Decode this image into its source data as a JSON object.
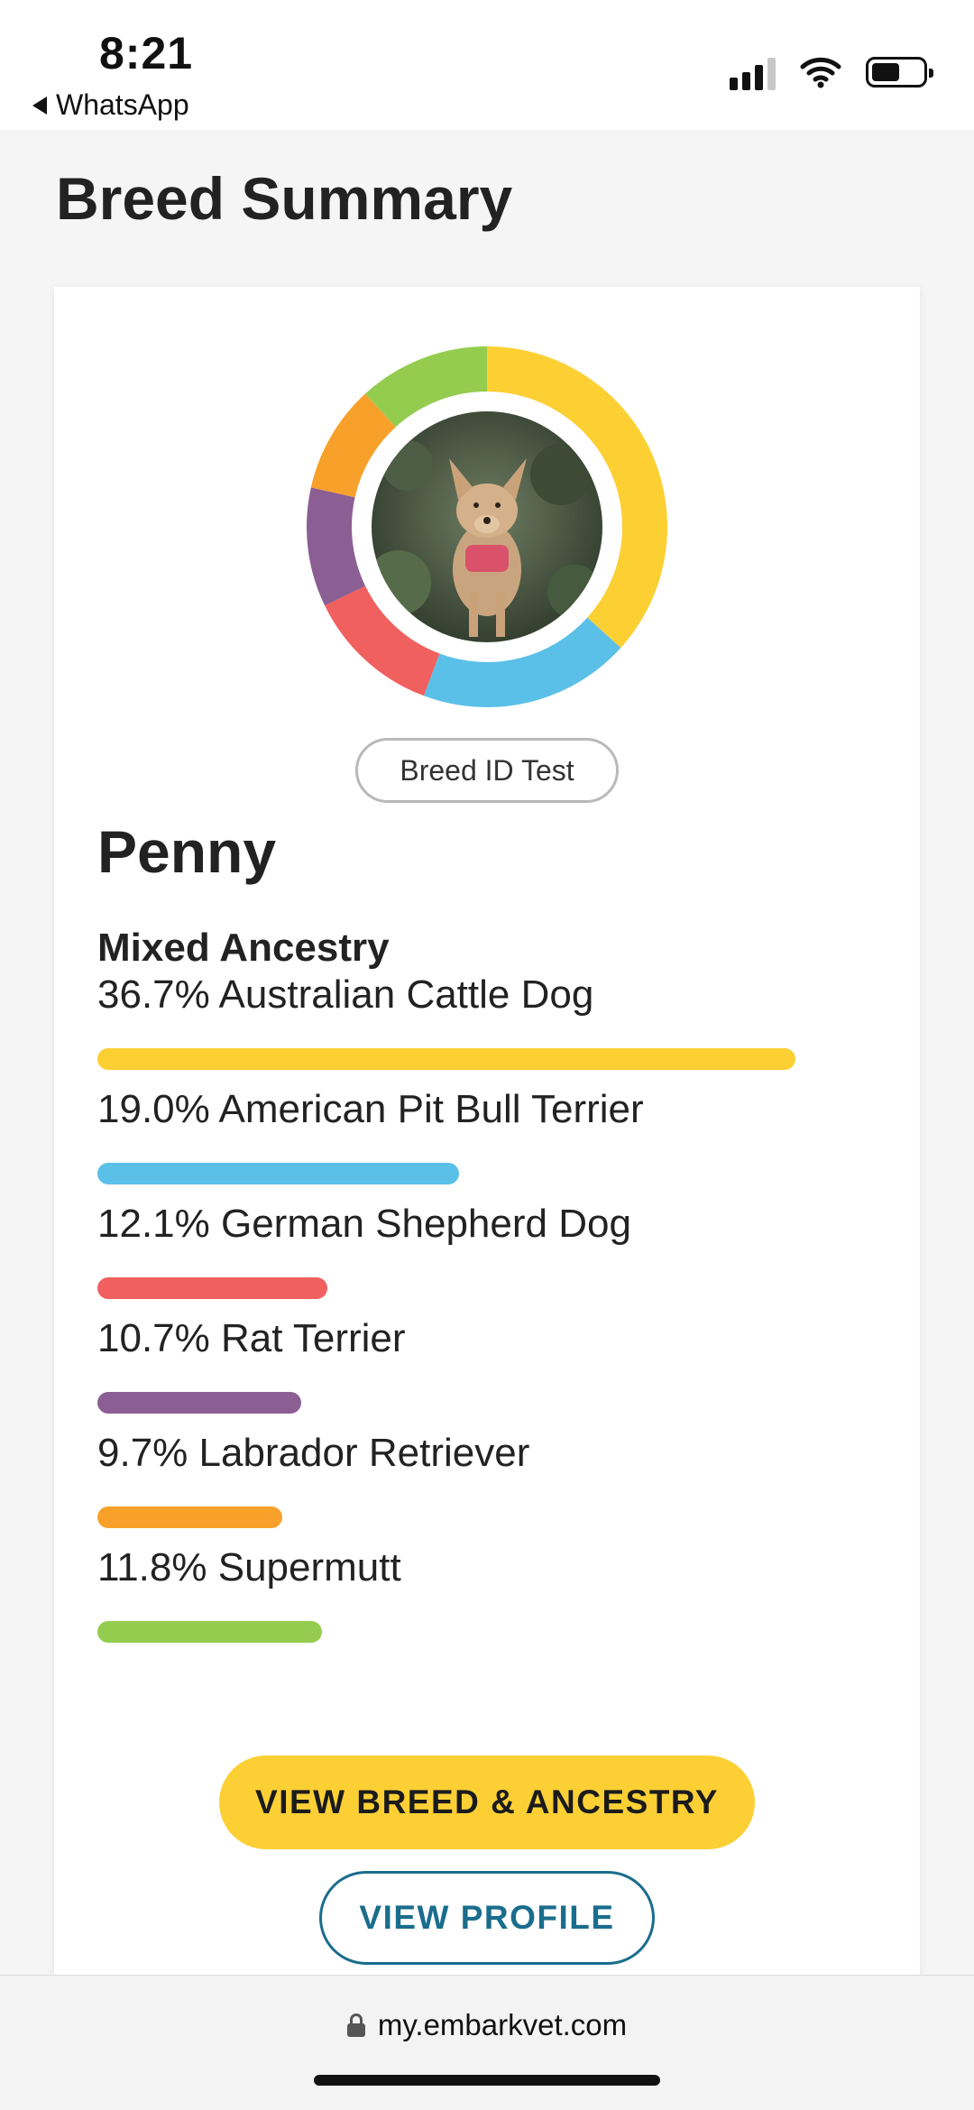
{
  "status_bar": {
    "time": "8:21",
    "back_app": "WhatsApp",
    "icons": [
      "cellular-signal-icon",
      "wifi-icon",
      "battery-icon"
    ]
  },
  "page": {
    "title": "Breed Summary"
  },
  "card": {
    "test_badge": "Breed ID Test",
    "dog_name": "Penny",
    "ancestry_heading": "Mixed Ancestry",
    "breeds": [
      {
        "label": "36.7% Australian Cattle Dog",
        "percent": 36.7,
        "color": "#fccf33"
      },
      {
        "label": "19.0% American Pit Bull Terrier",
        "percent": 19.0,
        "color": "#5bc0e8"
      },
      {
        "label": "12.1% German Shepherd Dog",
        "percent": 12.1,
        "color": "#f0605e"
      },
      {
        "label": "10.7% Rat Terrier",
        "percent": 10.7,
        "color": "#8c5f94"
      },
      {
        "label": "9.7% Labrador Retriever",
        "percent": 9.7,
        "color": "#f8a12a"
      },
      {
        "label": "11.8% Supermutt",
        "percent": 11.8,
        "color": "#94cc4f"
      }
    ],
    "primary_button": "VIEW BREED & ANCESTRY",
    "secondary_button": "VIEW PROFILE"
  },
  "url_bar": {
    "url": "my.embarkvet.com"
  }
}
